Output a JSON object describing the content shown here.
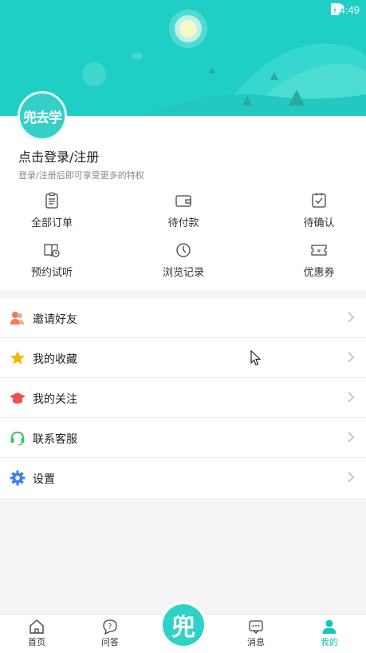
{
  "status_bar": {
    "time": "4:49"
  },
  "header": {
    "avatar_text": "兜去学"
  },
  "profile": {
    "login_title": "点击登录/注册",
    "login_subtitle": "登录/注册后即可享受更多的特权"
  },
  "shortcuts": [
    {
      "label": "全部订单",
      "icon": "clipboard-icon"
    },
    {
      "label": "待付款",
      "icon": "wallet-icon"
    },
    {
      "label": "待确认",
      "icon": "confirm-icon"
    },
    {
      "label": "预约试听",
      "icon": "book-clock-icon"
    },
    {
      "label": "浏览记录",
      "icon": "clock-icon"
    },
    {
      "label": "优惠券",
      "icon": "coupon-icon"
    }
  ],
  "menu": [
    {
      "label": "邀请好友",
      "icon": "invite-friend-icon",
      "color": "#f07a5a"
    },
    {
      "label": "我的收藏",
      "icon": "star-icon",
      "color": "#f5b800"
    },
    {
      "label": "我的关注",
      "icon": "graduation-cap-icon",
      "color": "#ef4e4e"
    },
    {
      "label": "联系客服",
      "icon": "headset-icon",
      "color": "#3cc45a"
    },
    {
      "label": "设置",
      "icon": "gear-icon",
      "color": "#3f7fe8"
    }
  ],
  "tabbar": {
    "tabs": [
      {
        "label": "首页",
        "icon": "home-icon"
      },
      {
        "label": "问答",
        "icon": "qa-icon"
      },
      {
        "label": "消息",
        "icon": "message-icon"
      },
      {
        "label": "我的",
        "icon": "profile-icon"
      }
    ],
    "center_text": "兜",
    "active_index": 3,
    "accent": "#14c6bd"
  }
}
